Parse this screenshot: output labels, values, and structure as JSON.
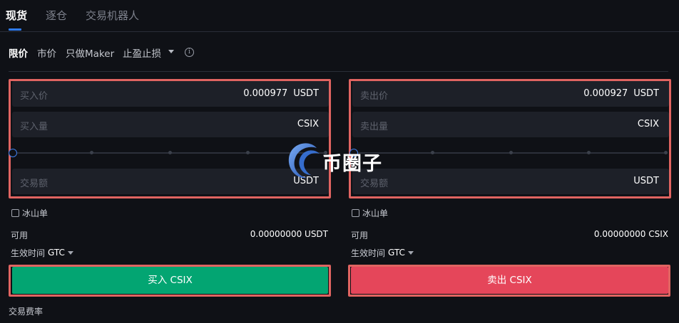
{
  "tabs": [
    {
      "label": "现货",
      "active": true
    },
    {
      "label": "逐仓",
      "active": false
    },
    {
      "label": "交易机器人",
      "active": false
    }
  ],
  "order_types": [
    {
      "label": "限价",
      "active": true
    },
    {
      "label": "市价",
      "active": false
    },
    {
      "label": "只做Maker",
      "active": false
    },
    {
      "label": "止盈止损",
      "active": false,
      "dropdown": true
    }
  ],
  "buy": {
    "price_label": "买入价",
    "price_value": "0.000977",
    "price_unit": "USDT",
    "amount_label": "买入量",
    "amount_unit": "CSIX",
    "total_label": "交易额",
    "total_unit": "USDT",
    "iceberg_label": "冰山单",
    "available_label": "可用",
    "available_value": "0.00000000 USDT",
    "tif_label": "生效时间",
    "tif_value": "GTC",
    "button_label": "买入 CSIX",
    "slider_percent": 0
  },
  "sell": {
    "price_label": "卖出价",
    "price_value": "0.000927",
    "price_unit": "USDT",
    "amount_label": "卖出量",
    "amount_unit": "CSIX",
    "total_label": "交易额",
    "total_unit": "USDT",
    "iceberg_label": "冰山单",
    "available_label": "可用",
    "available_value": "0.00000000 CSIX",
    "tif_label": "生效时间",
    "tif_value": "GTC",
    "button_label": "卖出 CSIX",
    "slider_percent": 0
  },
  "fee_label": "交易费率",
  "watermark": {
    "text": "币圈子",
    "icon": "logo-swirl-icon"
  },
  "colors": {
    "accent": "#2f7bf2",
    "buy": "#03a572",
    "sell": "#e5465a",
    "highlight_border": "#e06461",
    "background": "#0f1116",
    "field_bg": "#1d2028"
  }
}
